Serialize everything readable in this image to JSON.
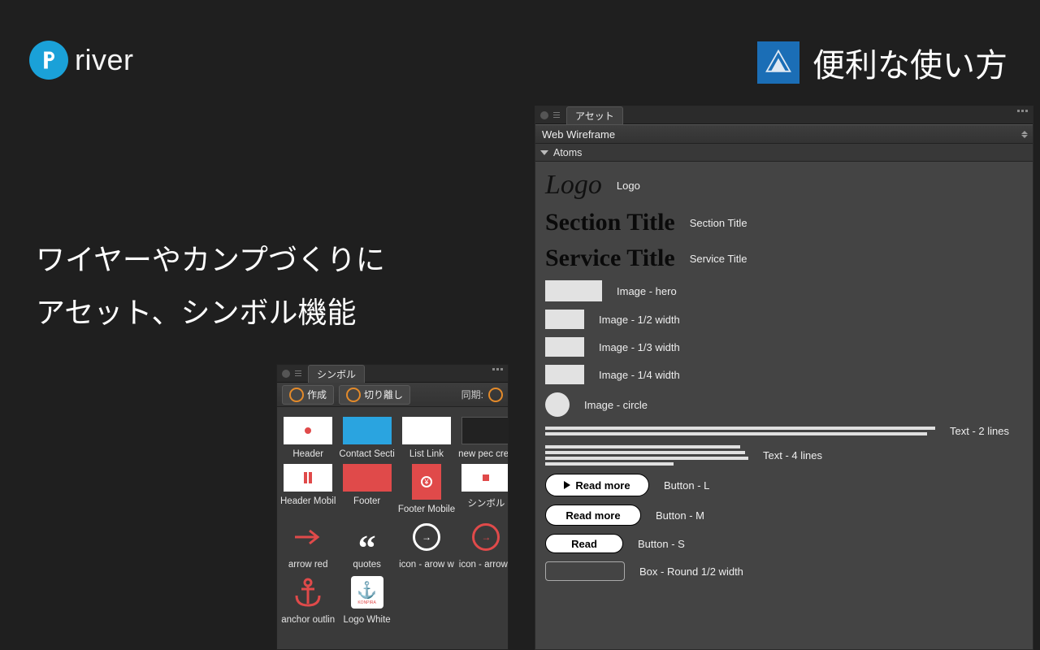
{
  "brand": {
    "name": "river"
  },
  "header": {
    "right_title": "便利な使い方"
  },
  "headline": {
    "line1": "ワイヤーやカンプづくりに",
    "line2": "アセット、シンボル機能"
  },
  "symbols_panel": {
    "tab": "シンボル",
    "toolbar": {
      "create": "作成",
      "detach": "切り離し",
      "sync": "同期:"
    },
    "items": [
      {
        "label": "Header"
      },
      {
        "label": "Contact Secti"
      },
      {
        "label": "List Link"
      },
      {
        "label": "new pec cred"
      },
      {
        "label": "Header Mobil"
      },
      {
        "label": "Footer"
      },
      {
        "label": "Footer Mobile"
      },
      {
        "label": "シンボル"
      },
      {
        "label": "arrow red"
      },
      {
        "label": "quotes"
      },
      {
        "label": "icon - arow w"
      },
      {
        "label": "icon - arrow r"
      },
      {
        "label": "anchor outlin"
      },
      {
        "label": "Logo White"
      }
    ]
  },
  "assets_panel": {
    "tab": "アセット",
    "library": "Web Wireframe",
    "group": "Atoms",
    "items": {
      "logo_preview": "Logo",
      "logo": "Logo",
      "section_title_preview": "Section Title",
      "section_title": "Section Title",
      "service_title_preview": "Service Title",
      "service_title": "Service Title",
      "image_hero": "Image - hero",
      "image_half": "Image - 1/2 width",
      "image_third": "Image - 1/3 width",
      "image_quarter": "Image - 1/4 width",
      "image_circle": "Image - circle",
      "text2": "Text - 2 lines",
      "text4": "Text - 4 lines",
      "button_l_text": "Read more",
      "button_l": "Button - L",
      "button_m_text": "Read more",
      "button_m": "Button - M",
      "button_s_text": "Read",
      "button_s": "Button - S",
      "box_round": "Box - Round 1/2 width"
    }
  }
}
